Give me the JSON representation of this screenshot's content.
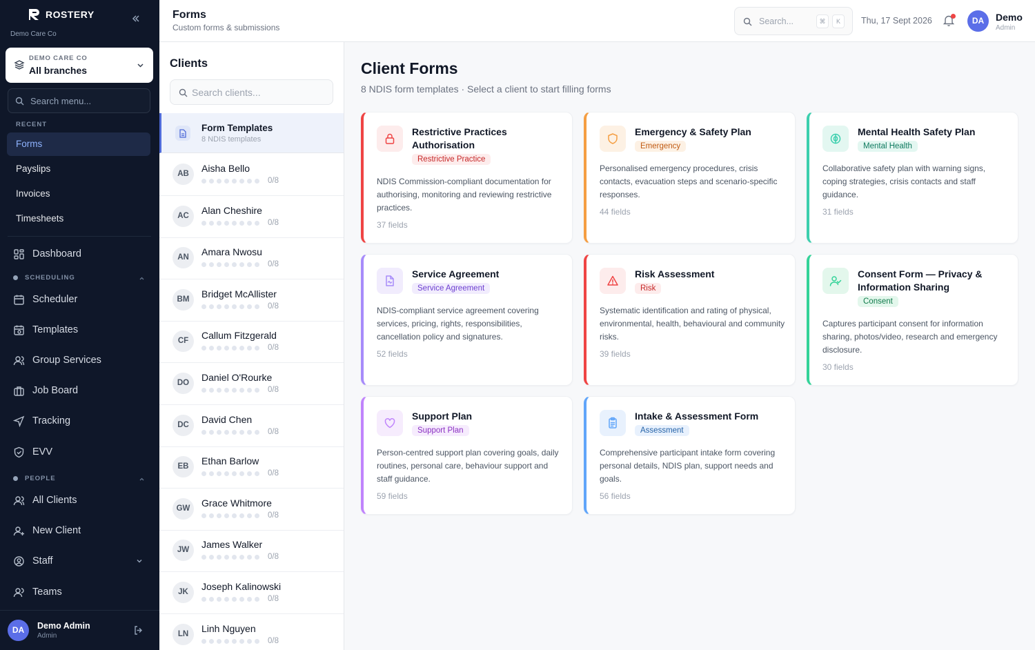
{
  "app": {
    "brand": "ROSTERY",
    "org_name": "Demo Care Co",
    "branch_label": "DEMO CARE CO",
    "branch_value": "All branches",
    "menu_search_placeholder": "Search menu..."
  },
  "sidebar": {
    "recent_label": "RECENT",
    "recent": [
      {
        "label": "Forms",
        "active": true
      },
      {
        "label": "Payslips"
      },
      {
        "label": "Invoices"
      },
      {
        "label": "Timesheets"
      }
    ],
    "dashboard": {
      "label": "Dashboard",
      "icon": "dashboard-icon"
    },
    "scheduling_label": "SCHEDULING",
    "scheduling": [
      {
        "label": "Scheduler",
        "icon": "calendar-icon"
      },
      {
        "label": "Templates",
        "icon": "calendar-template-icon"
      },
      {
        "label": "Group Services",
        "icon": "users-icon"
      },
      {
        "label": "Job Board",
        "icon": "briefcase-icon"
      },
      {
        "label": "Tracking",
        "icon": "navigation-icon"
      },
      {
        "label": "EVV",
        "icon": "shield-check-icon"
      }
    ],
    "people_label": "PEOPLE",
    "people": [
      {
        "label": "All Clients",
        "icon": "users-icon"
      },
      {
        "label": "New Client",
        "icon": "user-plus-icon"
      },
      {
        "label": "Staff",
        "icon": "staff-icon"
      },
      {
        "label": "Teams",
        "icon": "team-icon"
      }
    ],
    "user": {
      "initials": "DA",
      "name": "Demo Admin",
      "role": "Admin"
    }
  },
  "topbar": {
    "title": "Forms",
    "subtitle": "Custom forms & submissions",
    "search_placeholder": "Search...",
    "kbd_cmd": "⌘",
    "kbd_k": "K",
    "date": "Thu, 17 Sept 2026",
    "user_initials": "DA",
    "user_name": "Demo",
    "user_role": "Admin"
  },
  "clients_panel": {
    "title": "Clients",
    "search_placeholder": "Search clients...",
    "templates_row": {
      "title": "Form Templates",
      "subtitle": "8 NDIS templates"
    },
    "clients": [
      {
        "initials": "AB",
        "name": "Aisha Bello",
        "progress": "0/8"
      },
      {
        "initials": "AC",
        "name": "Alan Cheshire",
        "progress": "0/8"
      },
      {
        "initials": "AN",
        "name": "Amara Nwosu",
        "progress": "0/8"
      },
      {
        "initials": "BM",
        "name": "Bridget McAllister",
        "progress": "0/8"
      },
      {
        "initials": "CF",
        "name": "Callum Fitzgerald",
        "progress": "0/8"
      },
      {
        "initials": "DO",
        "name": "Daniel O'Rourke",
        "progress": "0/8"
      },
      {
        "initials": "DC",
        "name": "David Chen",
        "progress": "0/8"
      },
      {
        "initials": "EB",
        "name": "Ethan Barlow",
        "progress": "0/8"
      },
      {
        "initials": "GW",
        "name": "Grace Whitmore",
        "progress": "0/8"
      },
      {
        "initials": "JW",
        "name": "James Walker",
        "progress": "0/8"
      },
      {
        "initials": "JK",
        "name": "Joseph Kalinowski",
        "progress": "0/8"
      },
      {
        "initials": "LN",
        "name": "Linh Nguyen",
        "progress": "0/8"
      }
    ]
  },
  "main": {
    "title": "Client Forms",
    "subtitle": "8 NDIS form templates · Select a client to start filling forms",
    "cards": [
      {
        "title": "Restrictive Practices Authorisation",
        "badge": "Restrictive Practice",
        "desc": "NDIS Commission-compliant documentation for authorising, monitoring and reviewing restrictive practices.",
        "fields": "37 fields",
        "icon": "lock-icon",
        "color": "#ef4444",
        "tint": "#fdecec",
        "badge_text": "#c62828"
      },
      {
        "title": "Emergency & Safety Plan",
        "badge": "Emergency",
        "desc": "Personalised emergency procedures, crisis contacts, evacuation steps and scenario-specific responses.",
        "fields": "44 fields",
        "icon": "shield-icon",
        "color": "#f59e42",
        "tint": "#fdf1e4",
        "badge_text": "#c05a12"
      },
      {
        "title": "Mental Health Safety Plan",
        "badge": "Mental Health",
        "desc": "Collaborative safety plan with warning signs, coping strategies, crisis contacts and staff guidance.",
        "fields": "31 fields",
        "icon": "brain-icon",
        "color": "#3ccfae",
        "tint": "#e3f7f1",
        "badge_text": "#0f7a5f"
      },
      {
        "title": "Service Agreement",
        "badge": "Service Agreement",
        "desc": "NDIS-compliant service agreement covering services, pricing, rights, responsibilities, cancellation policy and signatures.",
        "fields": "52 fields",
        "icon": "file-signature-icon",
        "color": "#a78bfa",
        "tint": "#f1ecfd",
        "badge_text": "#6d3fd0"
      },
      {
        "title": "Risk Assessment",
        "badge": "Risk",
        "desc": "Systematic identification and rating of physical, environmental, health, behavioural and community risks.",
        "fields": "39 fields",
        "icon": "alert-triangle-icon",
        "color": "#ef4444",
        "tint": "#fdecec",
        "badge_text": "#c62828"
      },
      {
        "title": "Consent Form — Privacy & Information Sharing",
        "badge": "Consent",
        "desc": "Captures participant consent for information sharing, photos/video, research and emergency disclosure.",
        "fields": "30 fields",
        "icon": "user-check-icon",
        "color": "#34d399",
        "tint": "#e3f7ec",
        "badge_text": "#0f7a4a"
      },
      {
        "title": "Support Plan",
        "badge": "Support Plan",
        "desc": "Person-centred support plan covering goals, daily routines, personal care, behaviour support and staff guidance.",
        "fields": "59 fields",
        "icon": "heart-icon",
        "color": "#c084fc",
        "tint": "#f6ecfd",
        "badge_text": "#8a2fc2"
      },
      {
        "title": "Intake & Assessment Form",
        "badge": "Assessment",
        "desc": "Comprehensive participant intake form covering personal details, NDIS plan, support needs and goals.",
        "fields": "56 fields",
        "icon": "clipboard-icon",
        "color": "#60a5fa",
        "tint": "#e8f1fd",
        "badge_text": "#2563a8"
      }
    ]
  }
}
